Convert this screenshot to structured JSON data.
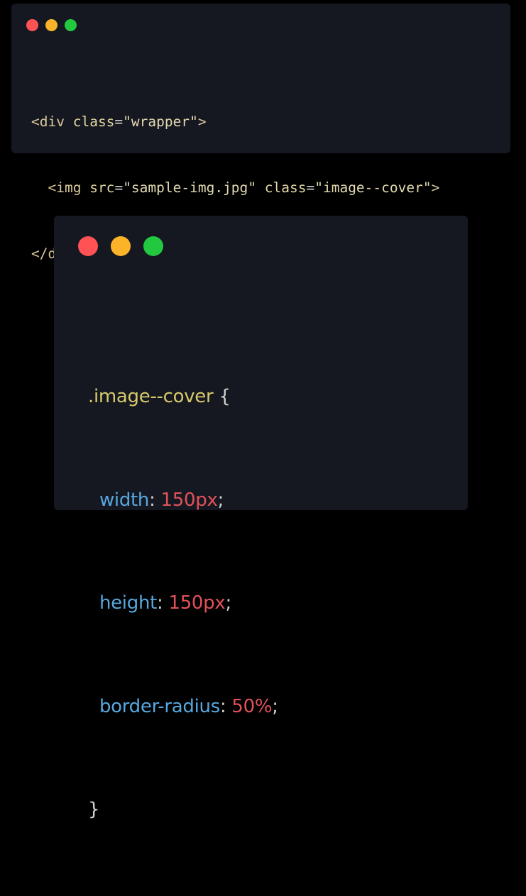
{
  "colors": {
    "background": "#000000",
    "window_bg": "#161821",
    "dot_red": "#ff5255",
    "dot_yellow": "#fbb32a",
    "dot_green": "#22c83f",
    "html_tag": "#d8c89a",
    "css_selector": "#d6c96a",
    "css_property": "#55a8df",
    "css_value": "#e0525a"
  },
  "html_snippet": {
    "line1": {
      "open": "<div",
      "attr": "class",
      "eq": "=",
      "value": "\"wrapper\"",
      "close": ">"
    },
    "line2": {
      "indent": "  ",
      "open": "<img",
      "attr1": "src",
      "eq1": "=",
      "value1": "\"sample-img.jpg\"",
      "attr2": "class",
      "eq2": "=",
      "value2": "\"image--cover\"",
      "close": ">"
    },
    "line3": {
      "tag": "</div>"
    }
  },
  "css_snippet": {
    "selector": ".image--cover",
    "open_brace": " {",
    "rules": [
      {
        "property": "width",
        "value": "150px"
      },
      {
        "property": "height",
        "value": "150px"
      },
      {
        "property": "border-radius",
        "value": "50%"
      }
    ],
    "close_brace": "}"
  }
}
